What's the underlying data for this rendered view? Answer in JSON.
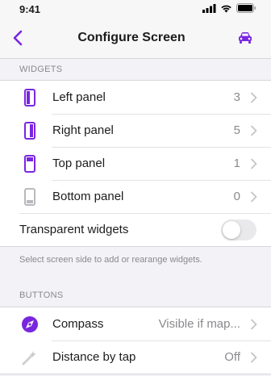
{
  "status_bar": {
    "time": "9:41"
  },
  "nav": {
    "title": "Configure Screen"
  },
  "widgets_section": {
    "header": "WIDGETS",
    "items": [
      {
        "label": "Left panel",
        "value": "3",
        "icon": "left-panel-icon"
      },
      {
        "label": "Right panel",
        "value": "5",
        "icon": "right-panel-icon"
      },
      {
        "label": "Top panel",
        "value": "1",
        "icon": "top-panel-icon"
      },
      {
        "label": "Bottom panel",
        "value": "0",
        "icon": "bottom-panel-icon"
      }
    ],
    "transparent_label": "Transparent widgets",
    "transparent_on": false,
    "note": "Select screen side to add or rearange widgets."
  },
  "buttons_section": {
    "header": "BUTTONS",
    "items": [
      {
        "label": "Compass",
        "value": "Visible if map...",
        "icon": "compass-icon"
      },
      {
        "label": "Distance by tap",
        "value": "Off",
        "icon": "distance-by-tap-icon"
      }
    ]
  },
  "colors": {
    "accent": "#7a26e0",
    "inactive": "#b9b9be"
  }
}
